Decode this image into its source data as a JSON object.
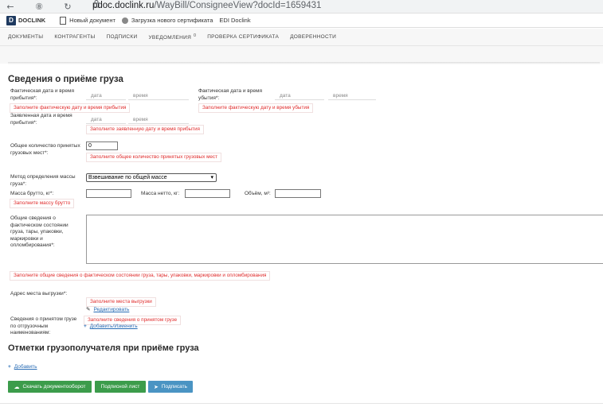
{
  "browser": {
    "back": "←",
    "forward": "⑧",
    "reload": "↻",
    "lock": "🔒",
    "url_host": "pdoc.doclink.ru",
    "url_path": "/WayBill/ConsigneeView?docId=1659431"
  },
  "bookmarks": [
    {
      "logo": "D",
      "label": "DOCLINK"
    },
    {
      "label": "Новый документ"
    },
    {
      "label": "Загрузка нового сертификата"
    },
    {
      "label": "EDI Doclink"
    }
  ],
  "nav": {
    "items": [
      "ДОКУМЕНТЫ",
      "КОНТРАГЕНТЫ",
      "ПОДПИСКИ",
      "УВЕДОМЛЕНИЯ",
      "ПРОВЕРКА СЕРТИФИКАТА",
      "ДОВЕРЕННОСТИ"
    ],
    "notifications_count": "0"
  },
  "section1": {
    "title": "Сведения о приёме груза",
    "actual_arrival_label": "Фактическая дата и время прибытия*:",
    "actual_departure_label": "Фактическая дата и время убытия*:",
    "declared_arrival_label": "Заявленная дата и время прибытия*:",
    "date_ph": "дата",
    "time_ph": "время",
    "err_actual_arrival": "Заполните фактическую дату и время прибытия",
    "err_actual_departure": "Заполните фактическую дату и время убытия",
    "err_declared_arrival": "Заполните заявленную дату и время прибытия",
    "qty_label": "Общее количество принятых грузовых мест*:",
    "qty_value": "0",
    "err_qty": "Заполните общее количество принятых грузовых мест",
    "mass_method_label": "Метод определения массы груза*:",
    "mass_method_value": "Взвешивание по общей массе",
    "gross_label": "Масса брутто, кг*:",
    "net_label": "Масса нетто, кг:",
    "volume_label": "Объём, м³:",
    "err_gross": "Заполните массу брутто",
    "condition_label": "Общие сведения о фактическом состоянии груза, тары, упаковки, маркировки и опломбирования*:",
    "err_condition": "Заполните общие сведения о фактическом состоянии груза, тары, упаковки, маркировки и опломбирования",
    "unload_label": "Адрес места выгрузки*:",
    "err_unload": "Заполните места выгрузки",
    "edit_link": "Редактировать",
    "accepted_label": "Сведения о принятом грузе по отгрузочным наименованиям:",
    "err_accepted": "Заполните сведения о принятом грузе",
    "add_change_link": "Добавить/Изменить"
  },
  "section2": {
    "title": "Отметки грузополучателя при приёме груза",
    "add_link": "Добавить"
  },
  "buttons": {
    "download": "Скачать документооборот",
    "sign_sheet": "Подписной лист",
    "sign": "Подписать"
  }
}
